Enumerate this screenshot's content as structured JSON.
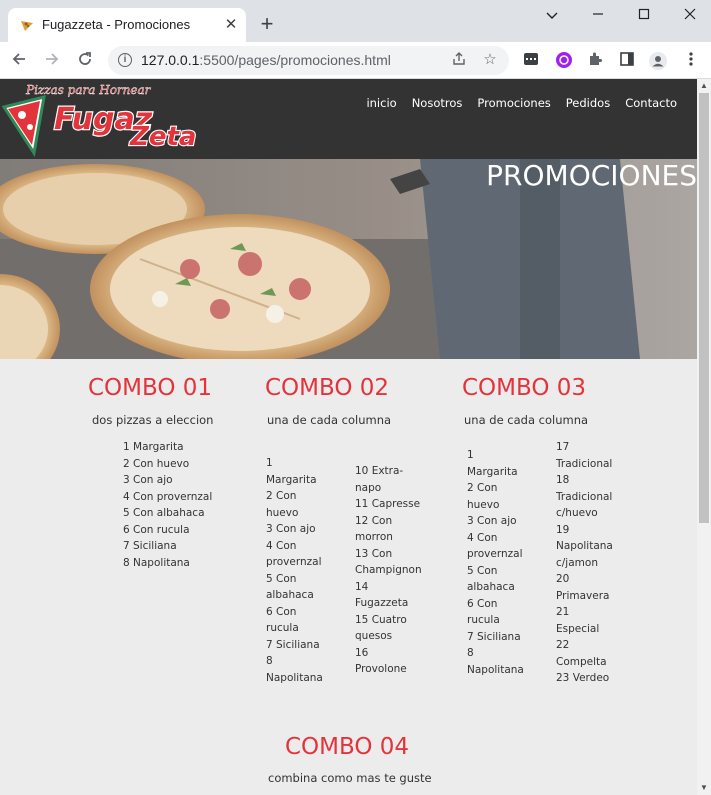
{
  "browser": {
    "tab_title": "Fugazzeta - Promociones",
    "url_host": "127.0.0.1",
    "url_port_path": ":5500/pages/promociones.html"
  },
  "site": {
    "logo_top": "Pizzas para Hornear",
    "logo_main": "FugazZeta",
    "nav": [
      "inicio",
      "Nosotros",
      "Promociones",
      "Pedidos",
      "Contacto"
    ],
    "hero_title": "PROMOCIONES"
  },
  "combos": {
    "c1": {
      "title": "COMBO 01",
      "subtitle": "dos pizzas a eleccion",
      "items": [
        "1 Margarita",
        "2 Con huevo",
        "3 Con ajo",
        "4 Con provernzal",
        "5 Con albahaca",
        "6 Con rucula",
        "7 Siciliana",
        "8 Napolitana"
      ]
    },
    "c2": {
      "title": "COMBO 02",
      "subtitle": "una de cada columna",
      "col1": [
        "1",
        "Margarita",
        "2 Con",
        "huevo",
        "3 Con ajo",
        "4 Con",
        "provernzal",
        "5 Con",
        "albahaca",
        "6 Con",
        "rucula",
        "7 Siciliana",
        "8",
        "Napolitana"
      ],
      "col2": [
        "10 Extra-",
        "napo",
        "11 Capresse",
        "12 Con",
        "morron",
        "13 Con",
        "Champignon",
        "14",
        "Fugazzeta",
        "15 Cuatro",
        "quesos",
        "16",
        "Provolone"
      ]
    },
    "c3": {
      "title": "COMBO 03",
      "subtitle": "una de cada columna",
      "col1": [
        "1",
        "Margarita",
        "2 Con",
        "huevo",
        "3 Con ajo",
        "4 Con",
        "provernzal",
        "5 Con",
        "albahaca",
        "6 Con",
        "rucula",
        "7 Siciliana",
        "8",
        "Napolitana"
      ],
      "col2": [
        "17",
        "Tradicional",
        "18",
        "Tradicional",
        "c/huevo",
        "19",
        "Napolitana",
        "c/jamon",
        "20",
        "Primavera",
        "21",
        "Especial",
        "22",
        "Compelta",
        "23 Verdeo"
      ]
    },
    "c4": {
      "title": "COMBO 04",
      "subtitle": "combina como mas te guste"
    }
  }
}
